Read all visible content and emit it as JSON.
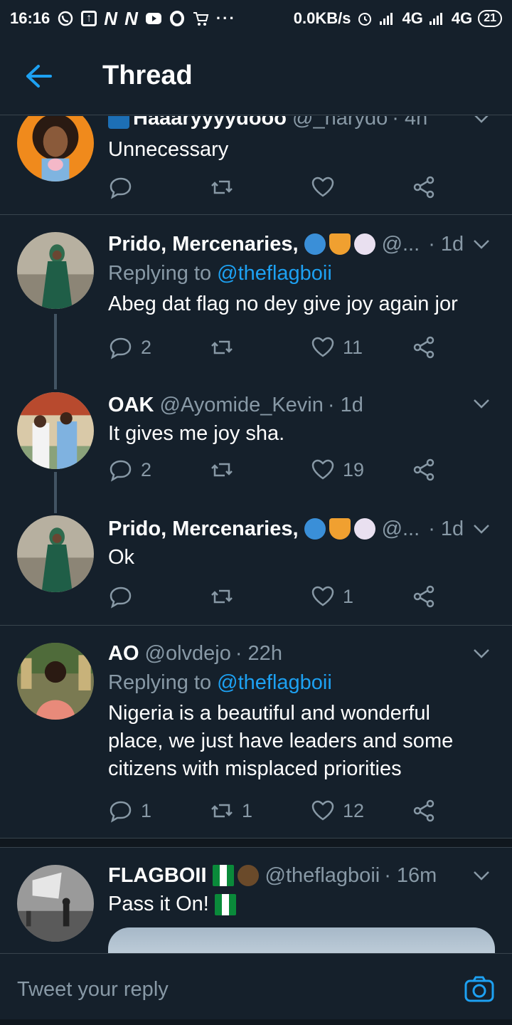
{
  "status_bar": {
    "time": "16:16",
    "net_speed": "0.0KB/s",
    "network1": "4G",
    "network2": "4G",
    "battery": "21"
  },
  "header": {
    "title": "Thread",
    "back_icon": "arrow-left-icon"
  },
  "colors": {
    "background": "#15202b",
    "accent": "#1da1f2",
    "muted": "#8899a6",
    "divider": "#38444d"
  },
  "tweets": [
    {
      "name": "Haaaryyyydooo",
      "handle": "@_harydo",
      "time": "· 4h",
      "text": "Unnecessary",
      "reply_count": "",
      "retweet_count": "",
      "like_count": ""
    },
    {
      "name": "Prido, Mercenaries,",
      "handle": "@...",
      "time": "· 1d",
      "replying_prefix": "Replying to",
      "replying_handle": "@theflagboii",
      "text": "Abeg dat flag no dey give joy again jor",
      "reply_count": "2",
      "retweet_count": "",
      "like_count": "11"
    },
    {
      "name": "OAK",
      "handle": "@Ayomide_Kevin",
      "time": "· 1d",
      "text": "It gives me joy sha.",
      "reply_count": "2",
      "retweet_count": "",
      "like_count": "19"
    },
    {
      "name": "Prido, Mercenaries,",
      "handle": "@...",
      "time": "· 1d",
      "text": "Ok",
      "reply_count": "",
      "retweet_count": "",
      "like_count": "1"
    },
    {
      "name": "AO",
      "handle": "@olvdejo",
      "time": "· 22h",
      "replying_prefix": "Replying to",
      "replying_handle": "@theflagboii",
      "text_lines": [
        "Nigeria is a beautiful and wonderful",
        "place, we just have leaders and some",
        "citizens with misplaced priorities"
      ],
      "reply_count": "1",
      "retweet_count": "1",
      "like_count": "12"
    },
    {
      "name": "FLAGBOII",
      "handle": "@theflagboii",
      "time": "· 16m",
      "text": "Pass it On!"
    }
  ],
  "compose": {
    "placeholder": "Tweet your reply",
    "camera_icon": "camera-icon"
  }
}
